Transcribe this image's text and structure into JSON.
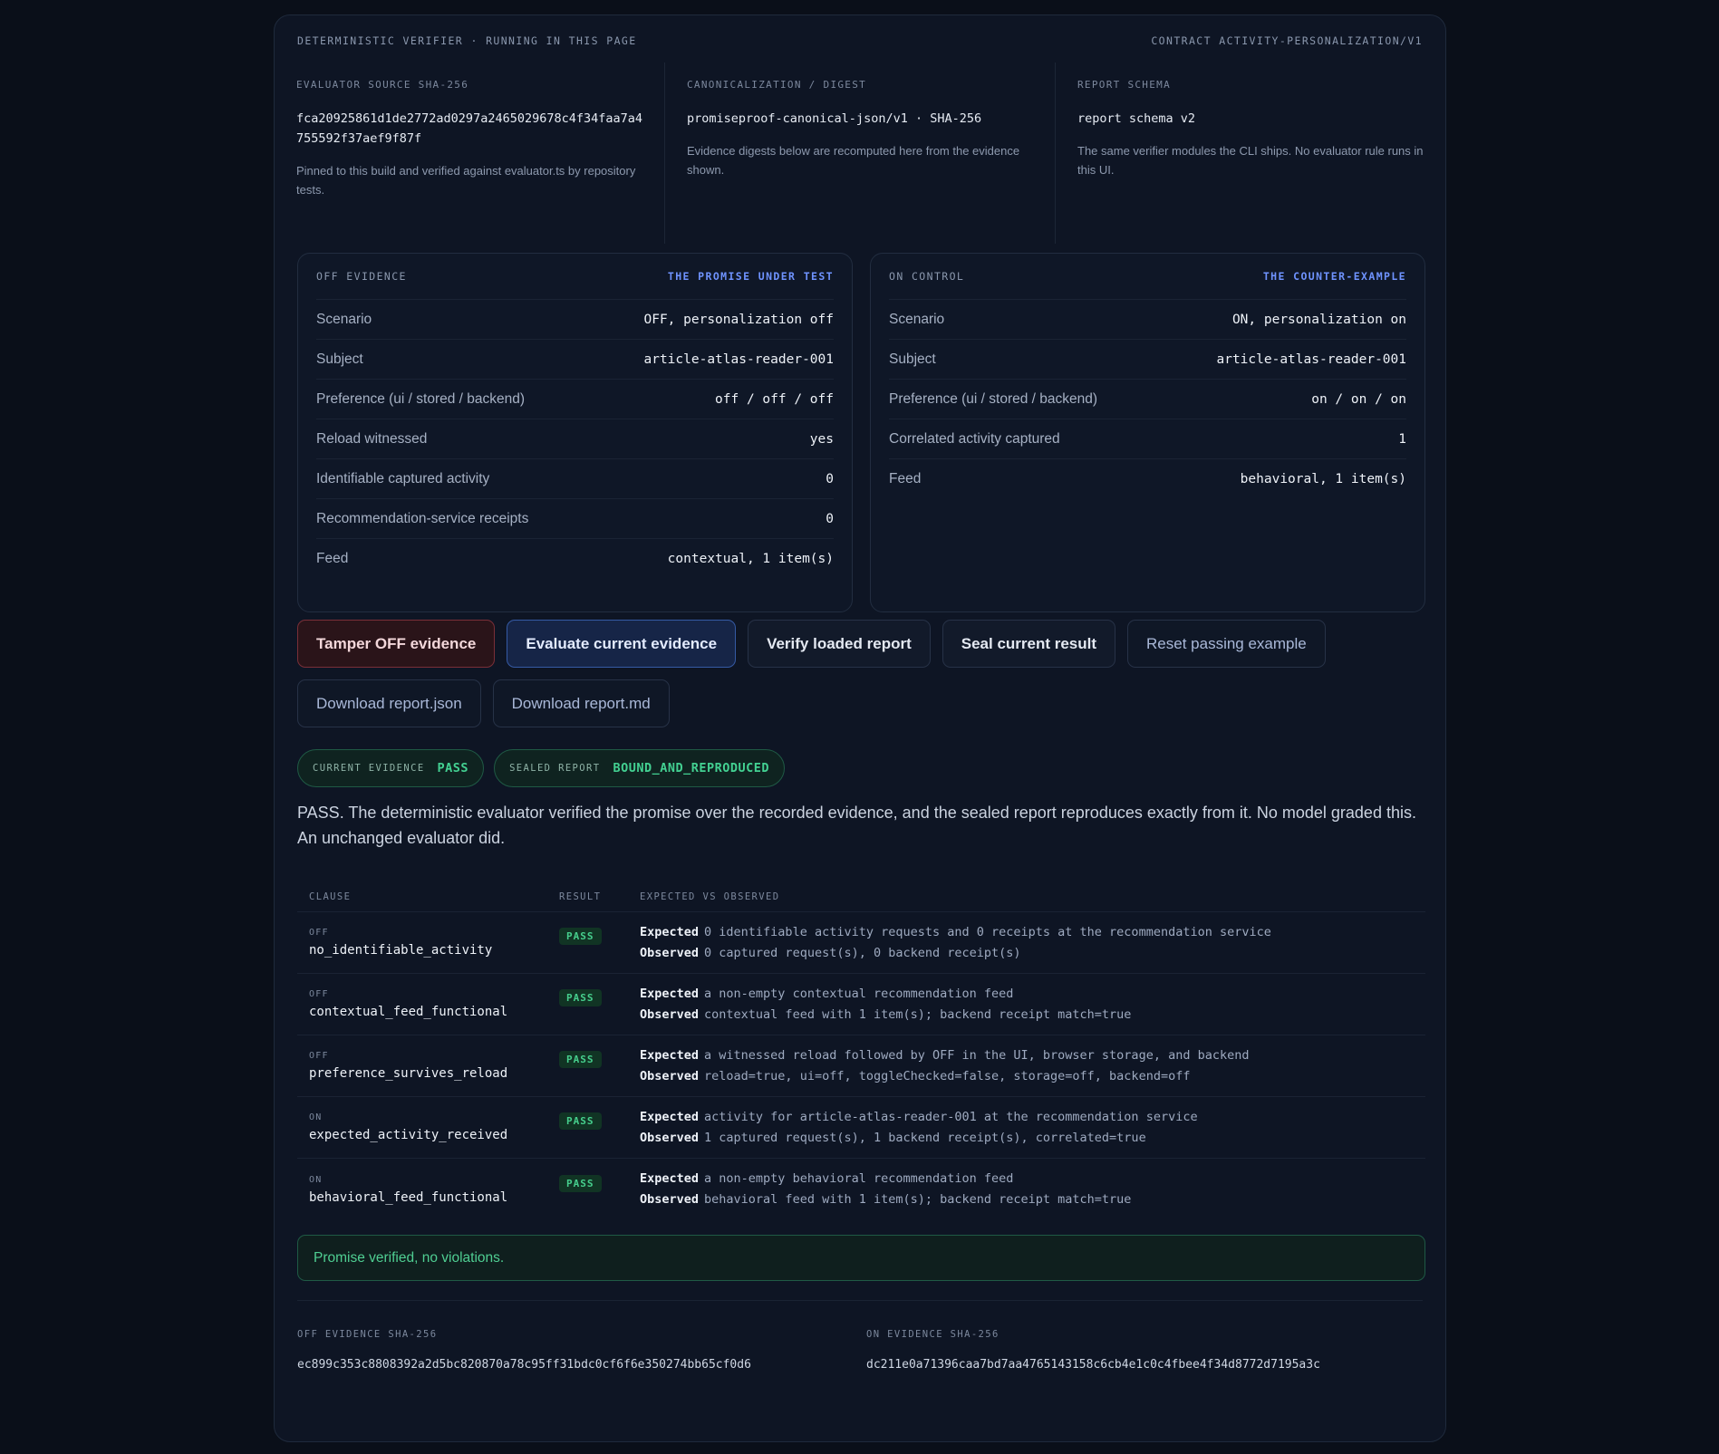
{
  "topbar": {
    "left": "Deterministic verifier · running in this page",
    "right": "Contract activity-personalization/v1"
  },
  "meta": [
    {
      "label": "Evaluator source SHA-256",
      "value": "fca20925861d1de2772ad0297a2465029678c4f34faa7a4755592f37aef9f87f",
      "note": "Pinned to this build and verified against evaluator.ts by repository tests."
    },
    {
      "label": "Canonicalization / digest",
      "value": "promiseproof-canonical-json/v1 · SHA-256",
      "note": "Evidence digests below are recomputed here from the evidence shown."
    },
    {
      "label": "Report schema",
      "value": "report schema v2",
      "note": "The same verifier modules the CLI ships. No evaluator rule runs in this UI."
    }
  ],
  "off_card": {
    "title": "OFF evidence",
    "tag": "The promise under test",
    "rows": [
      {
        "k": "Scenario",
        "v": "OFF, personalization off"
      },
      {
        "k": "Subject",
        "v": "article-atlas-reader-001"
      },
      {
        "k": "Preference (ui / stored / backend)",
        "v": "off / off / off"
      },
      {
        "k": "Reload witnessed",
        "v": "yes"
      },
      {
        "k": "Identifiable captured activity",
        "v": "0"
      },
      {
        "k": "Recommendation-service receipts",
        "v": "0"
      },
      {
        "k": "Feed",
        "v": "contextual, 1 item(s)"
      }
    ]
  },
  "on_card": {
    "title": "ON control",
    "tag": "The counter-example",
    "rows": [
      {
        "k": "Scenario",
        "v": "ON, personalization on"
      },
      {
        "k": "Subject",
        "v": "article-atlas-reader-001"
      },
      {
        "k": "Preference (ui / stored / backend)",
        "v": "on / on / on"
      },
      {
        "k": "Correlated activity captured",
        "v": "1"
      },
      {
        "k": "Feed",
        "v": "behavioral, 1 item(s)"
      }
    ]
  },
  "buttons": {
    "tamper": "Tamper OFF evidence",
    "evaluate": "Evaluate current evidence",
    "verify": "Verify loaded report",
    "seal": "Seal current result",
    "reset": "Reset passing example",
    "download_json": "Download report.json",
    "download_md": "Download report.md"
  },
  "badges": {
    "current_label": "Current evidence",
    "current_value": "PASS",
    "sealed_label": "Sealed report",
    "sealed_value": "BOUND_AND_REPRODUCED"
  },
  "summary": "PASS. The deterministic evaluator verified the promise over the recorded evidence, and the sealed report reproduces exactly from it. No model graded this. An unchanged evaluator did.",
  "clauses": {
    "headers": {
      "clause": "Clause",
      "result": "Result",
      "eo": "Expected vs observed"
    },
    "expected_label": "Expected",
    "observed_label": "Observed",
    "rows": [
      {
        "tag": "OFF",
        "name": "no_identifiable_activity",
        "result": "PASS",
        "expected": "0 identifiable activity requests and 0 receipts at the recommendation service",
        "observed": "0 captured request(s), 0 backend receipt(s)"
      },
      {
        "tag": "OFF",
        "name": "contextual_feed_functional",
        "result": "PASS",
        "expected": "a non-empty contextual recommendation feed",
        "observed": "contextual feed with 1 item(s); backend receipt match=true"
      },
      {
        "tag": "OFF",
        "name": "preference_survives_reload",
        "result": "PASS",
        "expected": "a witnessed reload followed by OFF in the UI, browser storage, and backend",
        "observed": "reload=true, ui=off, toggleChecked=false, storage=off, backend=off"
      },
      {
        "tag": "ON",
        "name": "expected_activity_received",
        "result": "PASS",
        "expected": "activity for article-atlas-reader-001 at the recommendation service",
        "observed": "1 captured request(s), 1 backend receipt(s), correlated=true"
      },
      {
        "tag": "ON",
        "name": "behavioral_feed_functional",
        "result": "PASS",
        "expected": "a non-empty behavioral recommendation feed",
        "observed": "behavioral feed with 1 item(s); backend receipt match=true"
      }
    ]
  },
  "verified_message": "Promise verified, no violations.",
  "digests": {
    "off_label": "OFF evidence SHA-256",
    "off_value": "ec899c353c8808392a2d5bc820870a78c95ff31bdc0cf6f6e350274bb65cf0d6",
    "on_label": "ON evidence SHA-256",
    "on_value": "dc211e0a71396caa7bd7aa4765143158c6cb4e1c0c4fbee4f34d8772d7195a3c"
  }
}
